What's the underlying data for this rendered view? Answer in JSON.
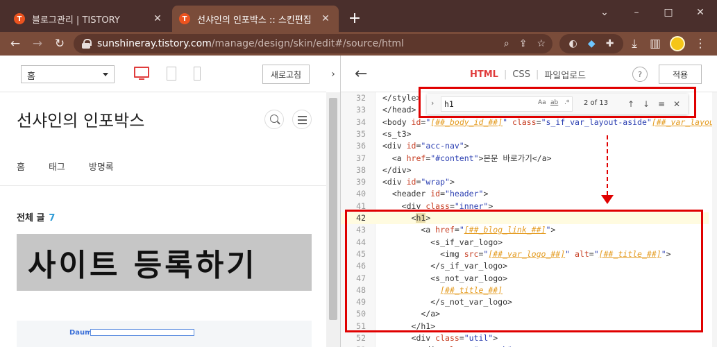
{
  "browser": {
    "tabs": [
      {
        "title": "블로그관리 | TISTORY",
        "favicon": "T"
      },
      {
        "title": "선샤인의 인포박스 :: 스킨편집",
        "favicon": "T"
      }
    ],
    "url": {
      "host": "sunshineray.tistory.com",
      "path": "/manage/design/skin/edit#/source/html"
    }
  },
  "preview": {
    "page_select": "홈",
    "refresh_label": "새로고침",
    "blog_title": "선샤인의 인포박스",
    "nav": [
      "홈",
      "태그",
      "방명록"
    ],
    "all_posts_label": "전체 글",
    "all_posts_count": "7",
    "thumbnail_text": "사이트 등록하기",
    "thumb2_logo": "Daum"
  },
  "editor": {
    "tabs": {
      "html": "HTML",
      "css": "CSS",
      "upload": "파일업로드"
    },
    "help_label": "?",
    "apply_label": "적용",
    "find": {
      "query": "h1",
      "count": "2 of 13",
      "opt_case": "Aa",
      "opt_word": "ab",
      "opt_regex": ".*"
    },
    "highlight_line": 42,
    "lines": [
      {
        "n": "32",
        "html": "&lt;/style&gt;"
      },
      {
        "n": "33",
        "html": "&lt;/head&gt;"
      },
      {
        "n": "34",
        "html": "&lt;body <span class=\"tok-attr\">id</span>=<span class=\"tok-str\">\"<span class=\"tok-var\">[##_body_id_##]</span>\"</span> <span class=\"tok-attr\">class</span>=<span class=\"tok-str\">\"s_if_var_layout-aside\"</span><span class=\"tok-var\">[##_var_layout_##]</span>"
      },
      {
        "n": "35",
        "html": "&lt;s_t3&gt;"
      },
      {
        "n": "36",
        "html": "&lt;div <span class=\"tok-attr\">id</span>=<span class=\"tok-str\">\"acc-nav\"</span>&gt;"
      },
      {
        "n": "37",
        "html": "  &lt;a <span class=\"tok-attr\">href</span>=<span class=\"tok-str\">\"#content\"</span>&gt;본문 바로가기&lt;/a&gt;"
      },
      {
        "n": "38",
        "html": "&lt;/div&gt;"
      },
      {
        "n": "39",
        "html": "&lt;div <span class=\"tok-attr\">id</span>=<span class=\"tok-str\">\"wrap\"</span>&gt;"
      },
      {
        "n": "40",
        "html": "  &lt;header <span class=\"tok-attr\">id</span>=<span class=\"tok-str\">\"header\"</span>&gt;"
      },
      {
        "n": "41",
        "html": "    &lt;div <span class=\"tok-attr\">class</span>=<span class=\"tok-str\">\"inner\"</span>&gt;"
      },
      {
        "n": "42",
        "html": "      &lt;<span class=\"tok-match\">h1</span>&gt;"
      },
      {
        "n": "43",
        "html": "        &lt;a <span class=\"tok-attr\">href</span>=<span class=\"tok-str\">\"<span class=\"tok-var\">[##_blog_link_##]</span>\"</span>&gt;"
      },
      {
        "n": "44",
        "html": "          &lt;s_if_var_logo&gt;"
      },
      {
        "n": "45",
        "html": "            &lt;img <span class=\"tok-attr\">src</span>=<span class=\"tok-str\">\"<span class=\"tok-var\">[##_var_logo_##]</span>\"</span> <span class=\"tok-attr\">alt</span>=<span class=\"tok-str\">\"<span class=\"tok-var\">[##_title_##]</span>\"</span>&gt;"
      },
      {
        "n": "46",
        "html": "          &lt;/s_if_var_logo&gt;"
      },
      {
        "n": "47",
        "html": "          &lt;s_not_var_logo&gt;"
      },
      {
        "n": "48",
        "html": "            <span class=\"tok-var\">[##_title_##]</span>"
      },
      {
        "n": "49",
        "html": "          &lt;/s_not_var_logo&gt;"
      },
      {
        "n": "50",
        "html": "        &lt;/a&gt;"
      },
      {
        "n": "51",
        "html": "      &lt;/h1&gt;"
      },
      {
        "n": "52",
        "html": "      &lt;div <span class=\"tok-attr\">class</span>=<span class=\"tok-str\">\"util\"</span>&gt;"
      },
      {
        "n": "53",
        "html": "        &lt;div <span class=\"tok-attr\">class</span>=<span class=\"tok-str\">\"search\"</span>&gt;"
      }
    ]
  },
  "colors": {
    "accent": "#e03c3c",
    "annotation": "#e00000",
    "chrome_dark": "#4a2f2c",
    "chrome": "#7a4c3a"
  }
}
